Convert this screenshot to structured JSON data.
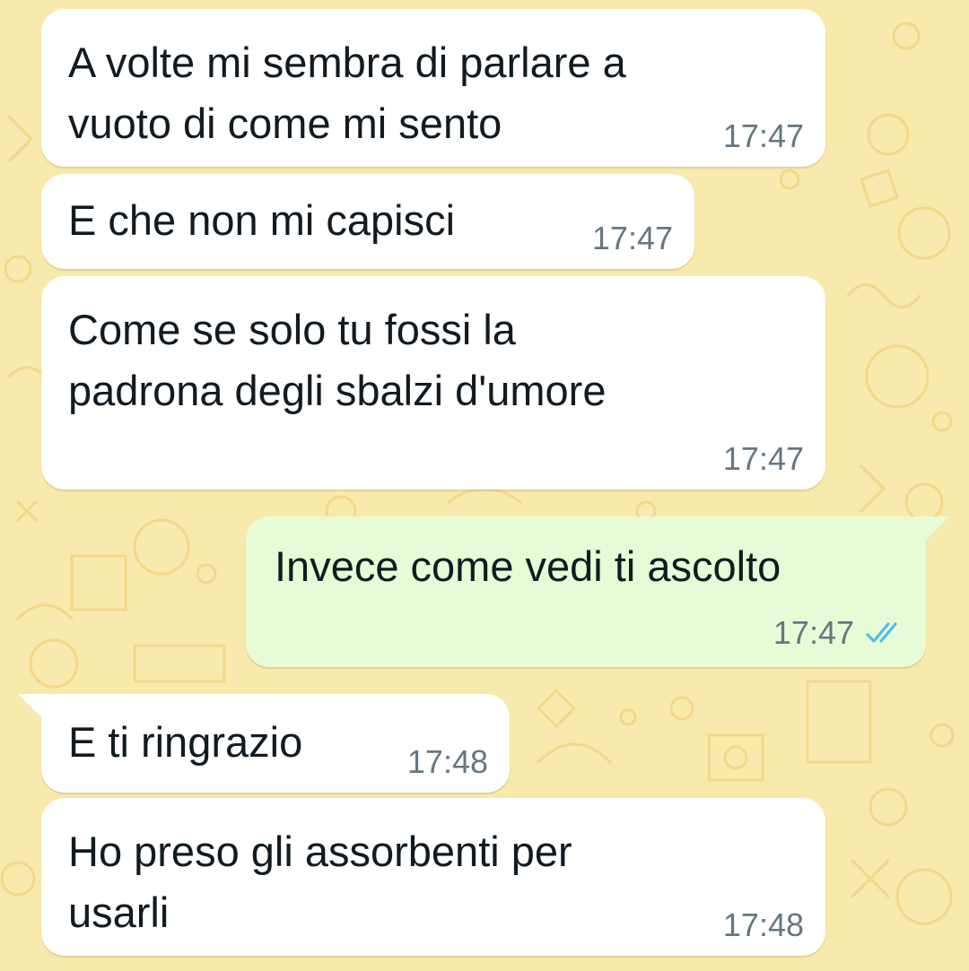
{
  "colors": {
    "wallpaper": "#f8e9ad",
    "incoming_bubble": "#ffffff",
    "outgoing_bubble": "#e7fcd6",
    "timestamp": "#667781",
    "read_ticks": "#53bdeb"
  },
  "messages": [
    {
      "direction": "incoming",
      "text": "A volte mi sembra di parlare a\nvuoto di come mi sento",
      "time": "17:47"
    },
    {
      "direction": "incoming",
      "text": "E che non mi capisci",
      "time": "17:47"
    },
    {
      "direction": "incoming",
      "text": "Come se solo tu fossi la\npadrona degli sbalzi d'umore",
      "time": "17:47"
    },
    {
      "direction": "outgoing",
      "text": "Invece come vedi ti ascolto",
      "time": "17:47",
      "status_icon": "double-check-read-icon"
    },
    {
      "direction": "incoming",
      "text": "E ti ringrazio",
      "time": "17:48"
    },
    {
      "direction": "incoming",
      "text": "Ho preso gli assorbenti per\nusarli",
      "time": "17:48"
    }
  ]
}
